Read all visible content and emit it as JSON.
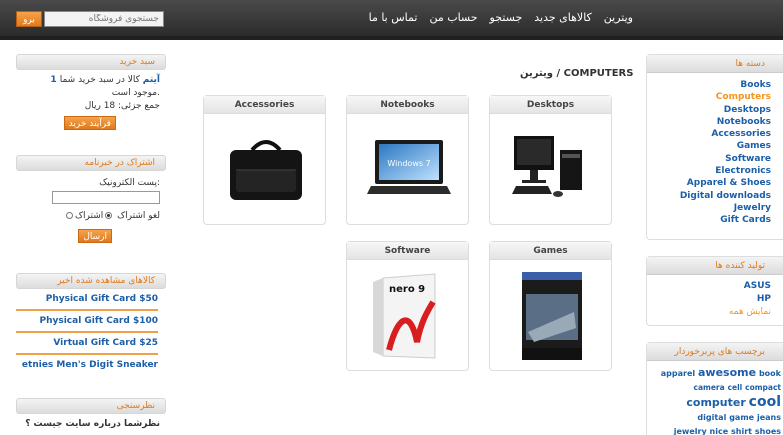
{
  "header": {
    "search_placeholder": "جستجوی فروشگاه",
    "search_button": "برو",
    "nav": [
      "ویترین",
      "کالاهای جدید",
      "جستجو",
      "حساب من",
      "تماس با ما"
    ]
  },
  "breadcrumb": "ویترین / COMPUTERS",
  "products": [
    {
      "title": "Desktops",
      "icon": "desktop-computer"
    },
    {
      "title": "Notebooks",
      "icon": "windows7-laptop"
    },
    {
      "title": "Accessories",
      "icon": "laptop-bag"
    },
    {
      "title": "Games",
      "icon": "need-for-speed-shift-box"
    },
    {
      "title": "Software",
      "icon": "nero9-box"
    }
  ],
  "categories": {
    "title": "دسته ها",
    "items": [
      "Books",
      "Computers",
      "Desktops",
      "Notebooks",
      "Accessories",
      "Games",
      "Software",
      "Electronics",
      "Apparel & Shoes",
      "Digital downloads",
      "Jewelry",
      "Gift Cards"
    ],
    "active_index": 1
  },
  "manufacturers": {
    "title": "تولید کننده ها",
    "items": [
      "ASUS",
      "HP"
    ],
    "more": "نمایش همه"
  },
  "tags": {
    "title": "برچسب های پربرخوردار",
    "items": [
      {
        "t": "apparel",
        "s": 8
      },
      {
        "t": "awesome",
        "s": 11
      },
      {
        "t": "book",
        "s": 8
      },
      {
        "t": "camera",
        "s": 7.5
      },
      {
        "t": "cell",
        "s": 7.5
      },
      {
        "t": "compact",
        "s": 7.5
      },
      {
        "t": "computer",
        "s": 11
      },
      {
        "t": "cool",
        "s": 14
      },
      {
        "t": "digital",
        "s": 8
      },
      {
        "t": "game",
        "s": 8
      },
      {
        "t": "jeans",
        "s": 8
      },
      {
        "t": "jewelry",
        "s": 8
      },
      {
        "t": "nice",
        "s": 8
      },
      {
        "t": "shirt",
        "s": 8
      },
      {
        "t": "shoes",
        "s": 8
      }
    ]
  },
  "cart": {
    "title": "سبد خرید",
    "count": "1 آیتم",
    "line1_suffix": "کالا در سبد خرید شما",
    "line2": "موجود است.",
    "total": "جمع جزئی: 18 ریال",
    "button": "فرآیند خرید"
  },
  "newsletter": {
    "title": "اشتراک در خبرنامه",
    "email_label": "پست الکترونیک:",
    "subscribe": "اشتراک",
    "unsubscribe": "لغو اشتراک",
    "button": "ارسال"
  },
  "recent": {
    "title": "کالاهای مشاهده شده اخیر",
    "items": [
      "Physical Gift Card $50",
      "Physical Gift Card $100",
      "Virtual Gift Card $25",
      "etnies Men's Digit Sneaker"
    ]
  },
  "poll": {
    "title": "نظرسنجی",
    "question": "نظرشما درباره سایت جیست ؟"
  },
  "colors": {
    "accent": "#f7941d",
    "link": "#1c5fa8",
    "header": "#333333"
  }
}
